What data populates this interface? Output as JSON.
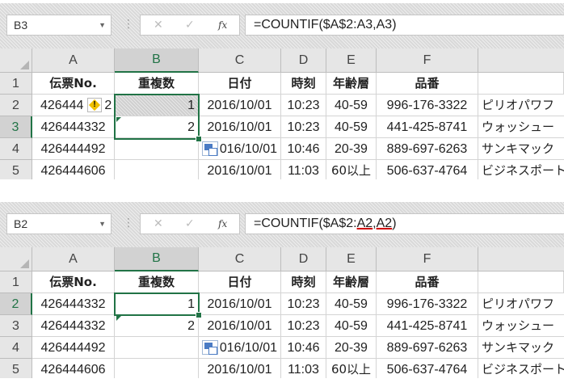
{
  "panels": [
    {
      "namebox": "B3",
      "formula": {
        "pre": "=COUNTIF($A$2:",
        "ref1": "A3",
        "mid": ",",
        "ref2": "A3",
        "post": ")"
      },
      "selected_col": "B",
      "selected_row": "3"
    },
    {
      "namebox": "B2",
      "formula": {
        "pre": "=COUNTIF($A$2:",
        "ref1": "A2",
        "mid": ",",
        "ref2": "A2",
        "post": ")"
      },
      "selected_col": "B",
      "selected_row": "2"
    }
  ],
  "columns": [
    "A",
    "B",
    "C",
    "D",
    "E",
    "F"
  ],
  "rows": [
    "1",
    "2",
    "3",
    "4",
    "5"
  ],
  "headers": [
    "伝票No.",
    "重複数",
    "日付",
    "時刻",
    "年齢層",
    "品番"
  ],
  "data_rows": [
    [
      "426444332",
      "1",
      "2016/10/01",
      "10:23",
      "40-59",
      "996-176-3322",
      "ピリオパワフ"
    ],
    [
      "426444332",
      "2",
      "2016/10/01",
      "10:23",
      "40-59",
      "441-425-8741",
      "ウォッシュー"
    ],
    [
      "426444492",
      "",
      "2016/10/01",
      "10:46",
      "20-39",
      "889-697-6263",
      "サンキマック"
    ],
    [
      "426444606",
      "",
      "2016/10/01",
      "11:03",
      "60以上",
      "506-637-4764",
      "ビジネスポート"
    ]
  ],
  "panel1_a2_display": "426444",
  "panel1_a2_tail": "2",
  "panel_bottom_c4_display": "016/10/01",
  "formula_bar": {
    "cancel_icon": "✕",
    "enter_icon": "✓",
    "fx_label": "fx",
    "dots": "⋮"
  },
  "colors": {
    "accent": "#217346",
    "error_red": "#d00000"
  }
}
